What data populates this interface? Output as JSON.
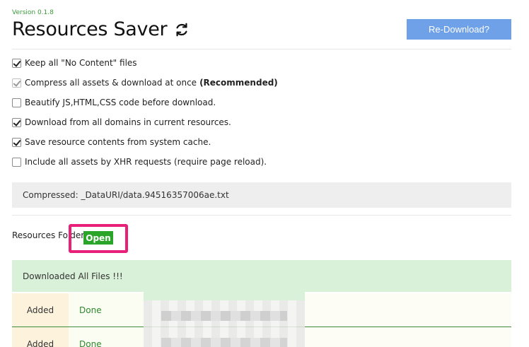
{
  "header": {
    "version": "Version 0.1.8",
    "title": "Resources Saver",
    "refresh_icon": "refresh-icon",
    "redownload_label": "Re-Download?"
  },
  "options": [
    {
      "label": "Keep all \"No Content\" files",
      "checked": true,
      "disabled": false,
      "bold_suffix": ""
    },
    {
      "label": "Compress all assets & download at once",
      "checked": true,
      "disabled": true,
      "bold_suffix": "(Recommended)"
    },
    {
      "label": "Beautify JS,HTML,CSS code before download.",
      "checked": false,
      "disabled": false,
      "bold_suffix": ""
    },
    {
      "label": "Download from all domains in current resources.",
      "checked": true,
      "disabled": false,
      "bold_suffix": ""
    },
    {
      "label": "Save resource contents from system cache.",
      "checked": true,
      "disabled": false,
      "bold_suffix": ""
    },
    {
      "label": "Include all assets by XHR requests (require page reload).",
      "checked": false,
      "disabled": false,
      "bold_suffix": ""
    }
  ],
  "compressed": {
    "text": "Compressed: _DataURI/data.94516357006ae.txt"
  },
  "folder": {
    "label": "Resources Folder:",
    "open_label": "Open"
  },
  "status": {
    "banner": "Downloaded All Files !!!"
  },
  "rows": [
    {
      "state": "Added",
      "result": "Done"
    },
    {
      "state": "Added",
      "result": "Done"
    }
  ],
  "colors": {
    "accent_blue": "#6fa1e8",
    "open_green": "#2aa52a",
    "highlight_pink": "#e8207a",
    "banner_green": "#d9f0d9"
  }
}
